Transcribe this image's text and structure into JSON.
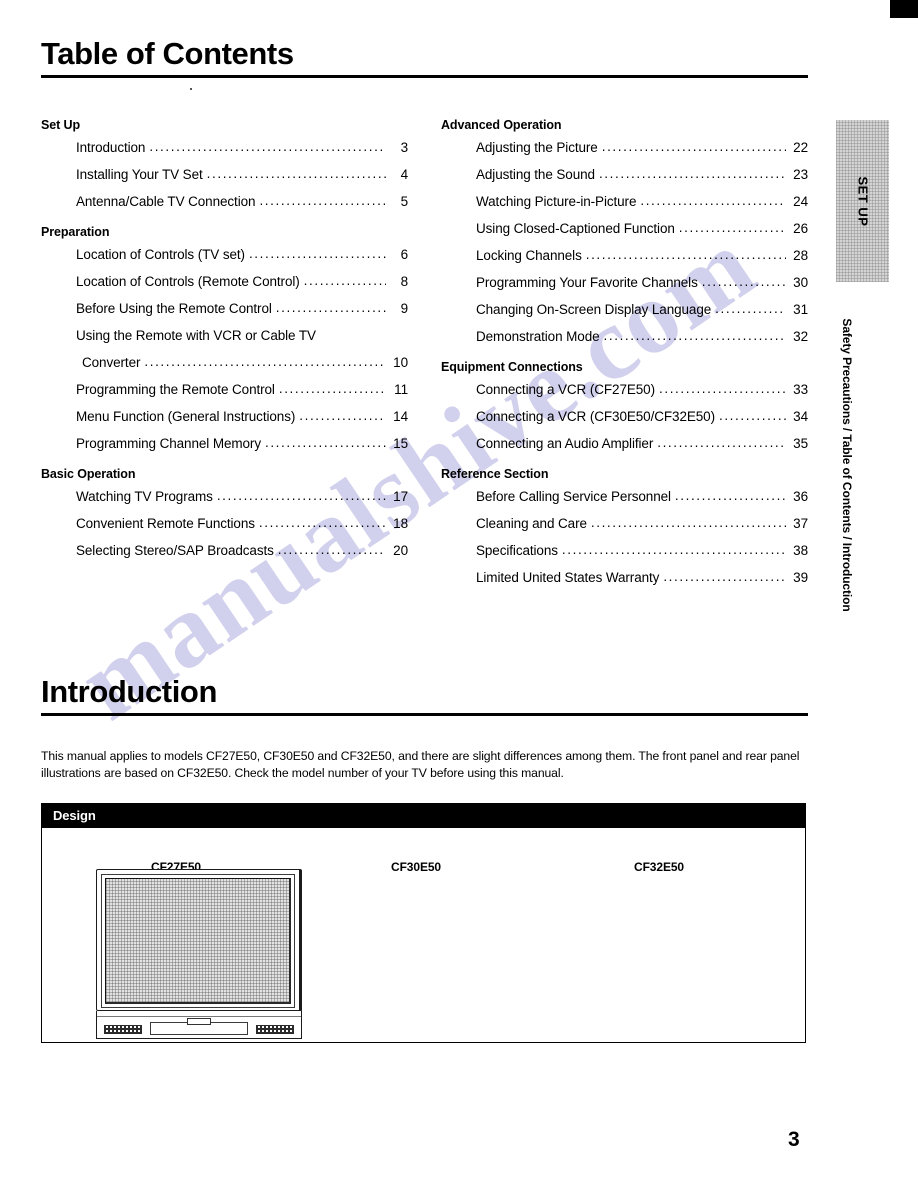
{
  "document": {
    "page_number": "3",
    "watermark_text": "manualshive.com"
  },
  "toc": {
    "heading": "Table of Contents",
    "left_column": [
      {
        "group": "Set Up",
        "entries": [
          {
            "label": "Introduction",
            "page": "3"
          },
          {
            "label": "Installing Your TV Set",
            "page": "4"
          },
          {
            "label": "Antenna/Cable TV Connection",
            "page": "5"
          }
        ]
      },
      {
        "group": "Preparation",
        "entries": [
          {
            "label": "Location of Controls (TV set)",
            "page": "6"
          },
          {
            "label": "Location of Controls (Remote Control)",
            "page": "8"
          },
          {
            "label": "Before Using the Remote Control",
            "page": "9"
          },
          {
            "label": "Using the Remote with VCR or Cable TV",
            "page": "",
            "nodots": true
          },
          {
            "label": "Converter",
            "page": "10",
            "continuation": true
          },
          {
            "label": "Programming the Remote Control",
            "page": "11"
          },
          {
            "label": "Menu Function (General Instructions)",
            "page": "14"
          },
          {
            "label": "Programming Channel Memory",
            "page": "15"
          }
        ]
      },
      {
        "group": "Basic Operation",
        "entries": [
          {
            "label": "Watching TV Programs",
            "page": "17"
          },
          {
            "label": "Convenient Remote Functions",
            "page": "18"
          },
          {
            "label": "Selecting Stereo/SAP Broadcasts",
            "page": "20"
          }
        ]
      }
    ],
    "right_column": [
      {
        "group": "Advanced Operation",
        "entries": [
          {
            "label": "Adjusting the Picture",
            "page": "22"
          },
          {
            "label": "Adjusting the Sound",
            "page": "23"
          },
          {
            "label": "Watching Picture-in-Picture",
            "page": "24"
          },
          {
            "label": "Using Closed-Captioned Function",
            "page": "26"
          },
          {
            "label": "Locking Channels",
            "page": "28"
          },
          {
            "label": "Programming Your Favorite Channels",
            "page": "30"
          },
          {
            "label": "Changing On-Screen Display Language",
            "page": "31"
          },
          {
            "label": "Demonstration Mode",
            "page": "32"
          }
        ]
      },
      {
        "group": "Equipment Connections",
        "entries": [
          {
            "label": "Connecting a VCR (CF27E50)",
            "page": "33"
          },
          {
            "label": "Connecting a VCR (CF30E50/CF32E50)",
            "page": "34"
          },
          {
            "label": "Connecting an Audio Amplifier",
            "page": "35"
          }
        ]
      },
      {
        "group": "Reference Section",
        "entries": [
          {
            "label": "Before Calling Service Personnel",
            "page": "36"
          },
          {
            "label": "Cleaning and Care",
            "page": "37"
          },
          {
            "label": "Specifications",
            "page": "38"
          },
          {
            "label": "Limited  United States Warranty",
            "page": "39"
          }
        ]
      }
    ]
  },
  "introduction": {
    "heading": "Introduction",
    "paragraph": "This manual applies to models CF27E50, CF30E50 and CF32E50, and there are slight differences among them.  The front panel and rear panel illustrations are based on CF32E50.  Check the model number of your TV before using this manual.",
    "design_box": {
      "title": "Design",
      "models": [
        "CF27E50",
        "CF30E50",
        "CF32E50"
      ]
    }
  },
  "sidebar": {
    "tab_label": "SET UP",
    "caption": "Safety Precautions / Table of Contents / Introduction"
  }
}
